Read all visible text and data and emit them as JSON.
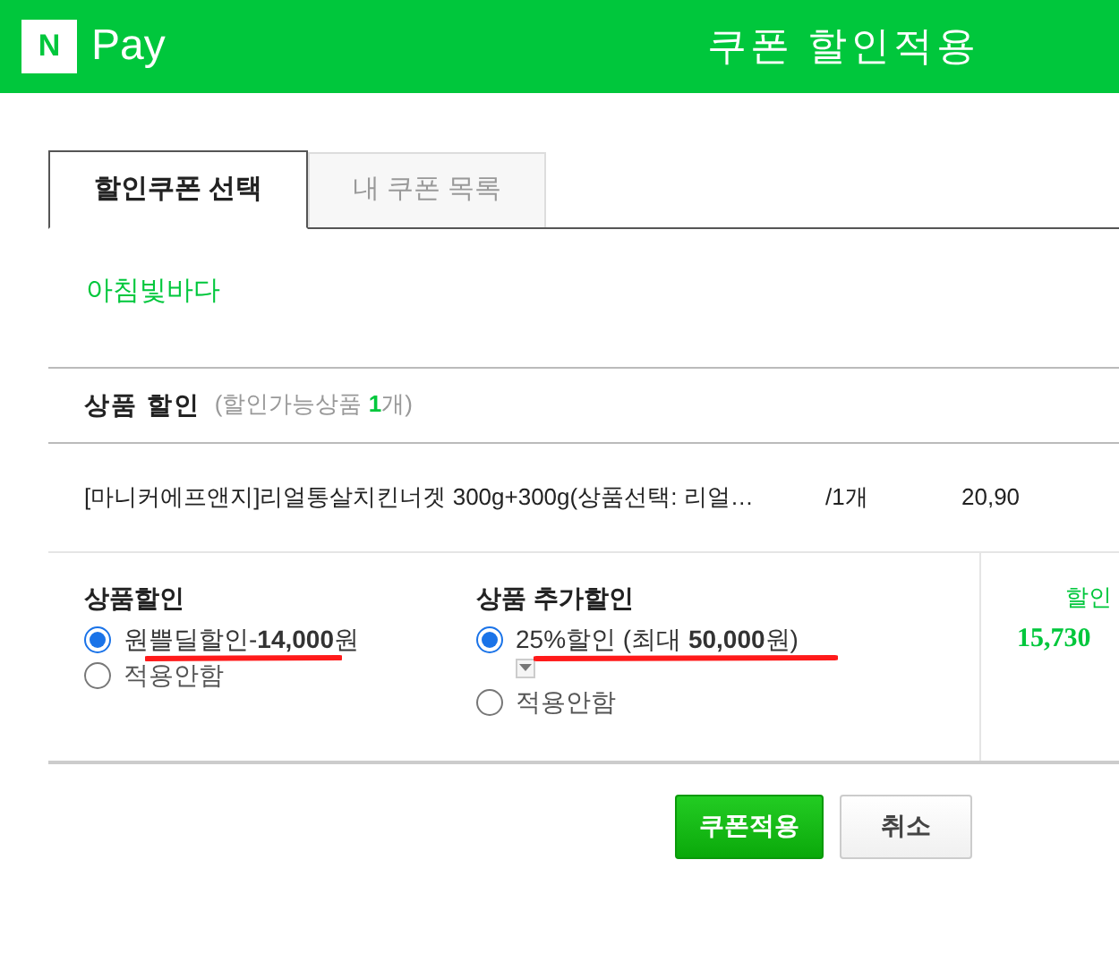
{
  "header": {
    "logo_letter": "N",
    "brand": "Pay",
    "title": "쿠폰 할인적용"
  },
  "tabs": [
    {
      "label": "할인쿠폰 선택",
      "selected": true
    },
    {
      "label": "내 쿠폰 목록",
      "selected": false
    }
  ],
  "shop_name": "아침빛바다",
  "section": {
    "title": "상품 할인",
    "note_prefix": "(할인가능상품 ",
    "note_count": "1",
    "note_suffix": "개)"
  },
  "product": {
    "name": "[마니커에프앤지]리얼통살치킨너겟 300g+300g(상품선택: 리얼…",
    "quantity": "/1개",
    "price": "20,90"
  },
  "option_groups": [
    {
      "title": "상품할인",
      "options": [
        {
          "label": "원쁠딜할인-**14,000**원",
          "selected": true,
          "dropdown": false,
          "underlined": true
        },
        {
          "label": "적용안함",
          "selected": false,
          "dropdown": false,
          "underlined": false
        }
      ]
    },
    {
      "title": "상품 추가할인",
      "options": [
        {
          "label": "25%할인 (최대 **50,000**원)",
          "selected": true,
          "dropdown": true,
          "underlined": true
        },
        {
          "label": "적용안함",
          "selected": false,
          "dropdown": false,
          "underlined": false
        }
      ]
    }
  ],
  "discount": {
    "label": "할인",
    "amount": "15,730"
  },
  "buttons": [
    {
      "label": "쿠폰적용",
      "kind": "primary"
    },
    {
      "label": "취소",
      "kind": "secondary"
    }
  ]
}
